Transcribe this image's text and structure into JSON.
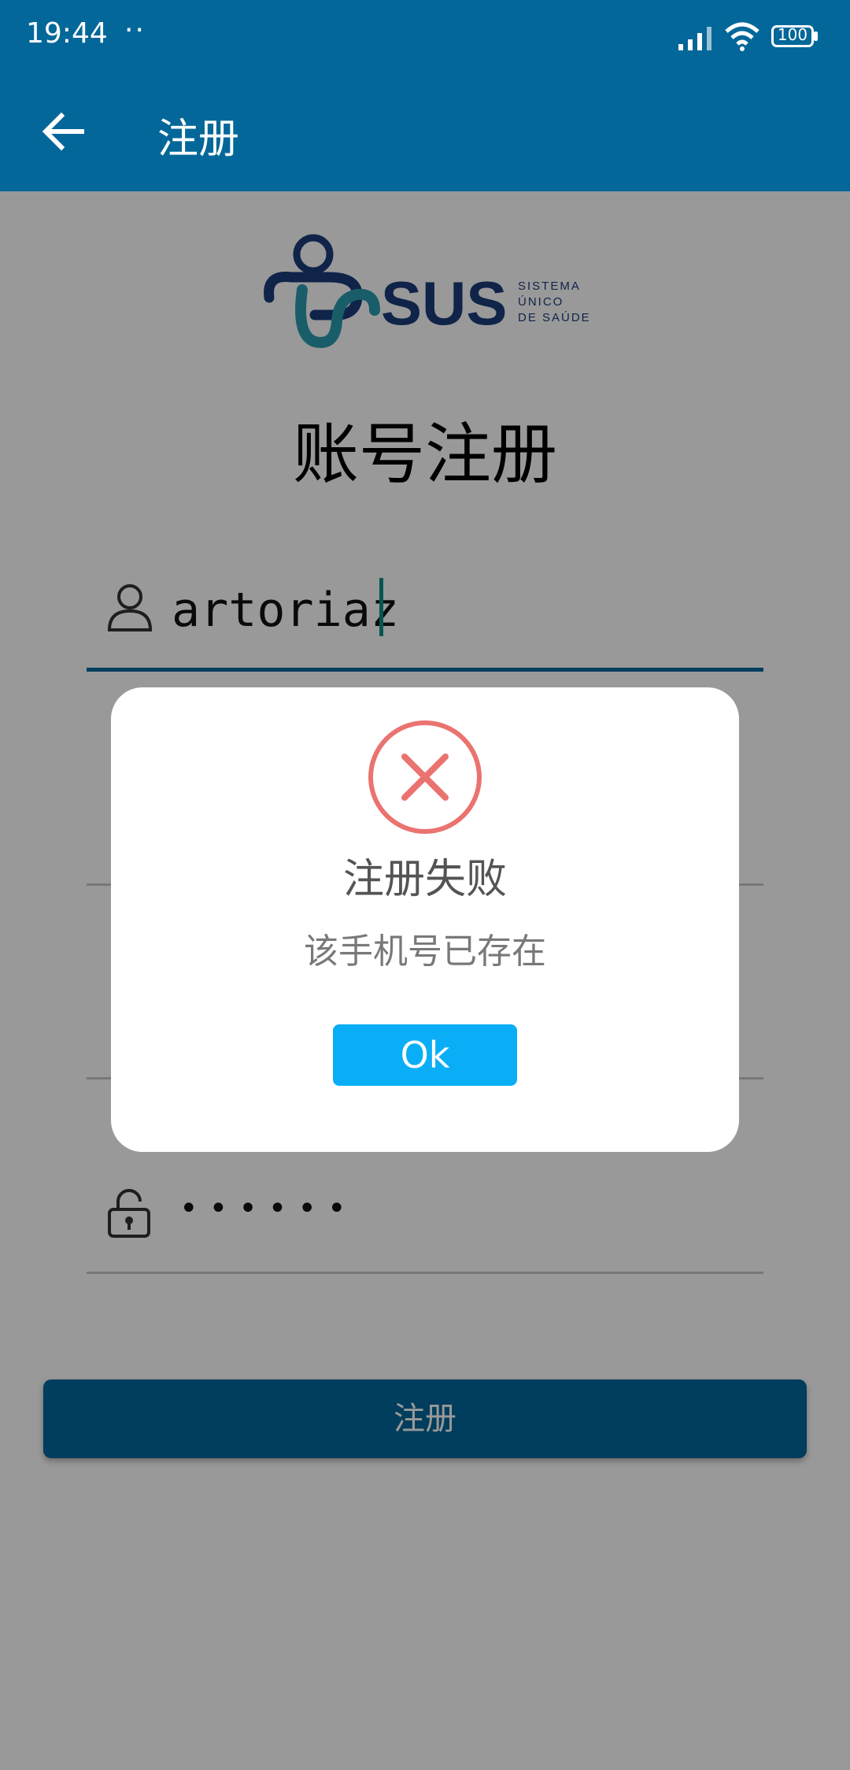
{
  "status_bar": {
    "time": "19:44",
    "dots": "··",
    "battery": "100"
  },
  "app_bar": {
    "title": "注册"
  },
  "logo": {
    "wordmark": "SUS",
    "tagline_lines": [
      "SISTEMA",
      "ÚNICO",
      "DE SAÚDE"
    ]
  },
  "form": {
    "heading": "账号注册",
    "username_value": "artoriaz",
    "password_mask": "••••••"
  },
  "register_button_label": "注册",
  "dialog": {
    "title": "注册失败",
    "message": "该手机号已存在",
    "ok_label": "Ok"
  },
  "colors": {
    "primary": "#036799",
    "dialog_button": "#0aaef6",
    "error_icon": "#ea7370"
  }
}
